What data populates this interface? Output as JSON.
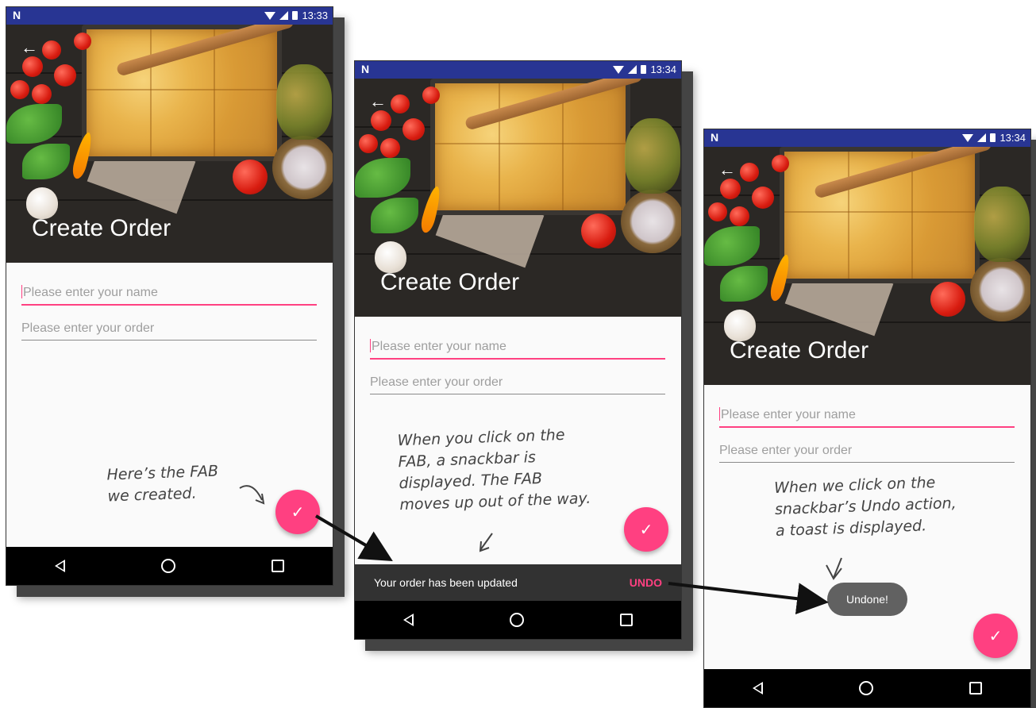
{
  "screens": [
    {
      "status_time": "13:33",
      "title": "Create Order",
      "name_placeholder": "Please enter your name",
      "order_placeholder": "Please enter your order"
    },
    {
      "status_time": "13:34",
      "title": "Create Order",
      "name_placeholder": "Please enter your name",
      "order_placeholder": "Please enter your order",
      "snackbar_text": "Your order has been updated",
      "snackbar_action": "UNDO"
    },
    {
      "status_time": "13:34",
      "title": "Create Order",
      "name_placeholder": "Please enter your name",
      "order_placeholder": "Please enter your order",
      "toast_text": "Undone!"
    }
  ],
  "annotations": {
    "fab_note": "Here’s the FAB\nwe created.",
    "snackbar_note": "When you click on the\nFAB, a snackbar is\ndisplayed. The FAB\nmoves up out of the way.",
    "toast_note": "When we click on the\nsnackbar’s Undo action,\na toast is displayed."
  },
  "icons": {
    "status_logo": "N",
    "fab_icon": "✓",
    "back_icon": "←"
  },
  "colors": {
    "status_bar": "#283593",
    "accent": "#ff4081",
    "snackbar": "#323232",
    "toast": "#616161"
  }
}
